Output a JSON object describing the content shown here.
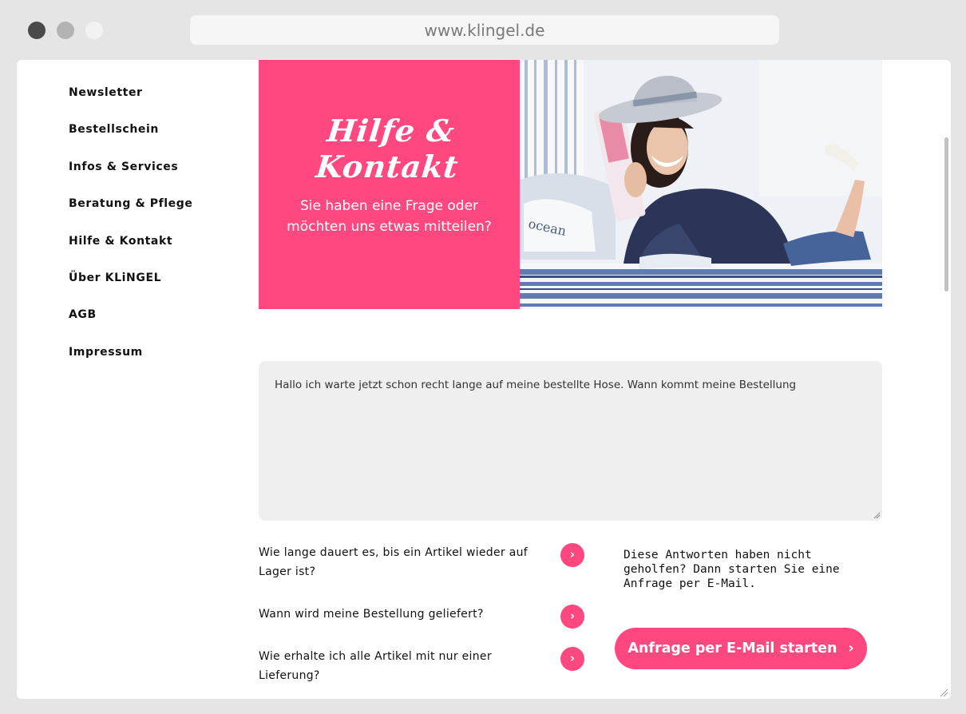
{
  "browser": {
    "url": "www.klingel.de"
  },
  "sidebar": {
    "items": [
      {
        "label": "Newsletter"
      },
      {
        "label": "Bestellschein"
      },
      {
        "label": "Infos & Services"
      },
      {
        "label": "Beratung & Pflege"
      },
      {
        "label": "Hilfe & Kontakt"
      },
      {
        "label": "Über KLiNGEL"
      },
      {
        "label": "AGB"
      },
      {
        "label": "Impressum"
      }
    ]
  },
  "hero": {
    "title": "Hilfe & Kontakt",
    "subtitle_line1": "Sie haben eine Frage oder",
    "subtitle_line2": "möchten uns etwas mitteilen?",
    "accent_color": "#ff4880"
  },
  "message": {
    "value": "Hallo ich warte jetzt schon recht lange auf meine bestellte Hose. Wann kommt meine Bestellung"
  },
  "faq": {
    "items": [
      {
        "line1": "Wie lange dauert es, bis ein Artikel wieder auf",
        "line2": "Lager ist?"
      },
      {
        "line1": "Wann wird meine Bestellung geliefert?",
        "line2": ""
      },
      {
        "line1": "Wie erhalte ich alle Artikel mit nur einer",
        "line2": "Lieferung?"
      }
    ],
    "arrow_glyph": "›"
  },
  "helper": {
    "line1": "Diese Antworten haben nicht",
    "line2": "geholfen? Dann starten Sie eine",
    "line3": "Anfrage per E-Mail."
  },
  "cta": {
    "label": "Anfrage per E-Mail starten",
    "arrow_glyph": "›"
  }
}
